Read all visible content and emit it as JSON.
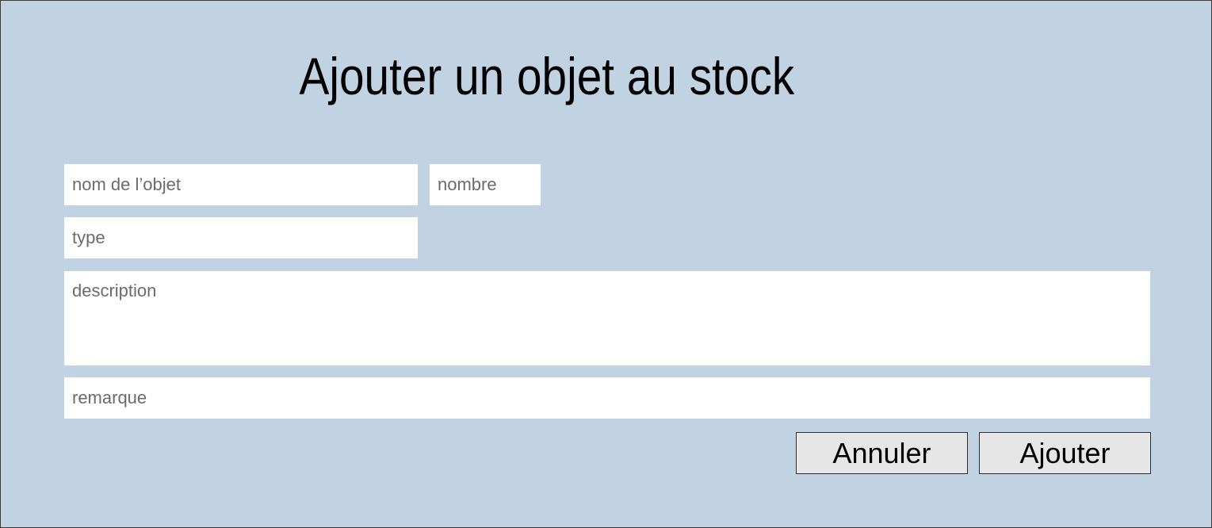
{
  "dialog": {
    "title": "Ajouter un objet au stock"
  },
  "form": {
    "nom": {
      "placeholder": "nom de l’objet",
      "value": ""
    },
    "nombre": {
      "placeholder": "nombre",
      "value": ""
    },
    "type": {
      "placeholder": "type",
      "value": ""
    },
    "description": {
      "placeholder": "description",
      "value": ""
    },
    "remarque": {
      "placeholder": "remarque",
      "value": ""
    }
  },
  "actions": {
    "cancel_label": "Annuler",
    "add_label": "Ajouter"
  },
  "colors": {
    "background": "#c1d2e2",
    "field_background": "#ffffff",
    "button_background": "#e6e6e6"
  }
}
